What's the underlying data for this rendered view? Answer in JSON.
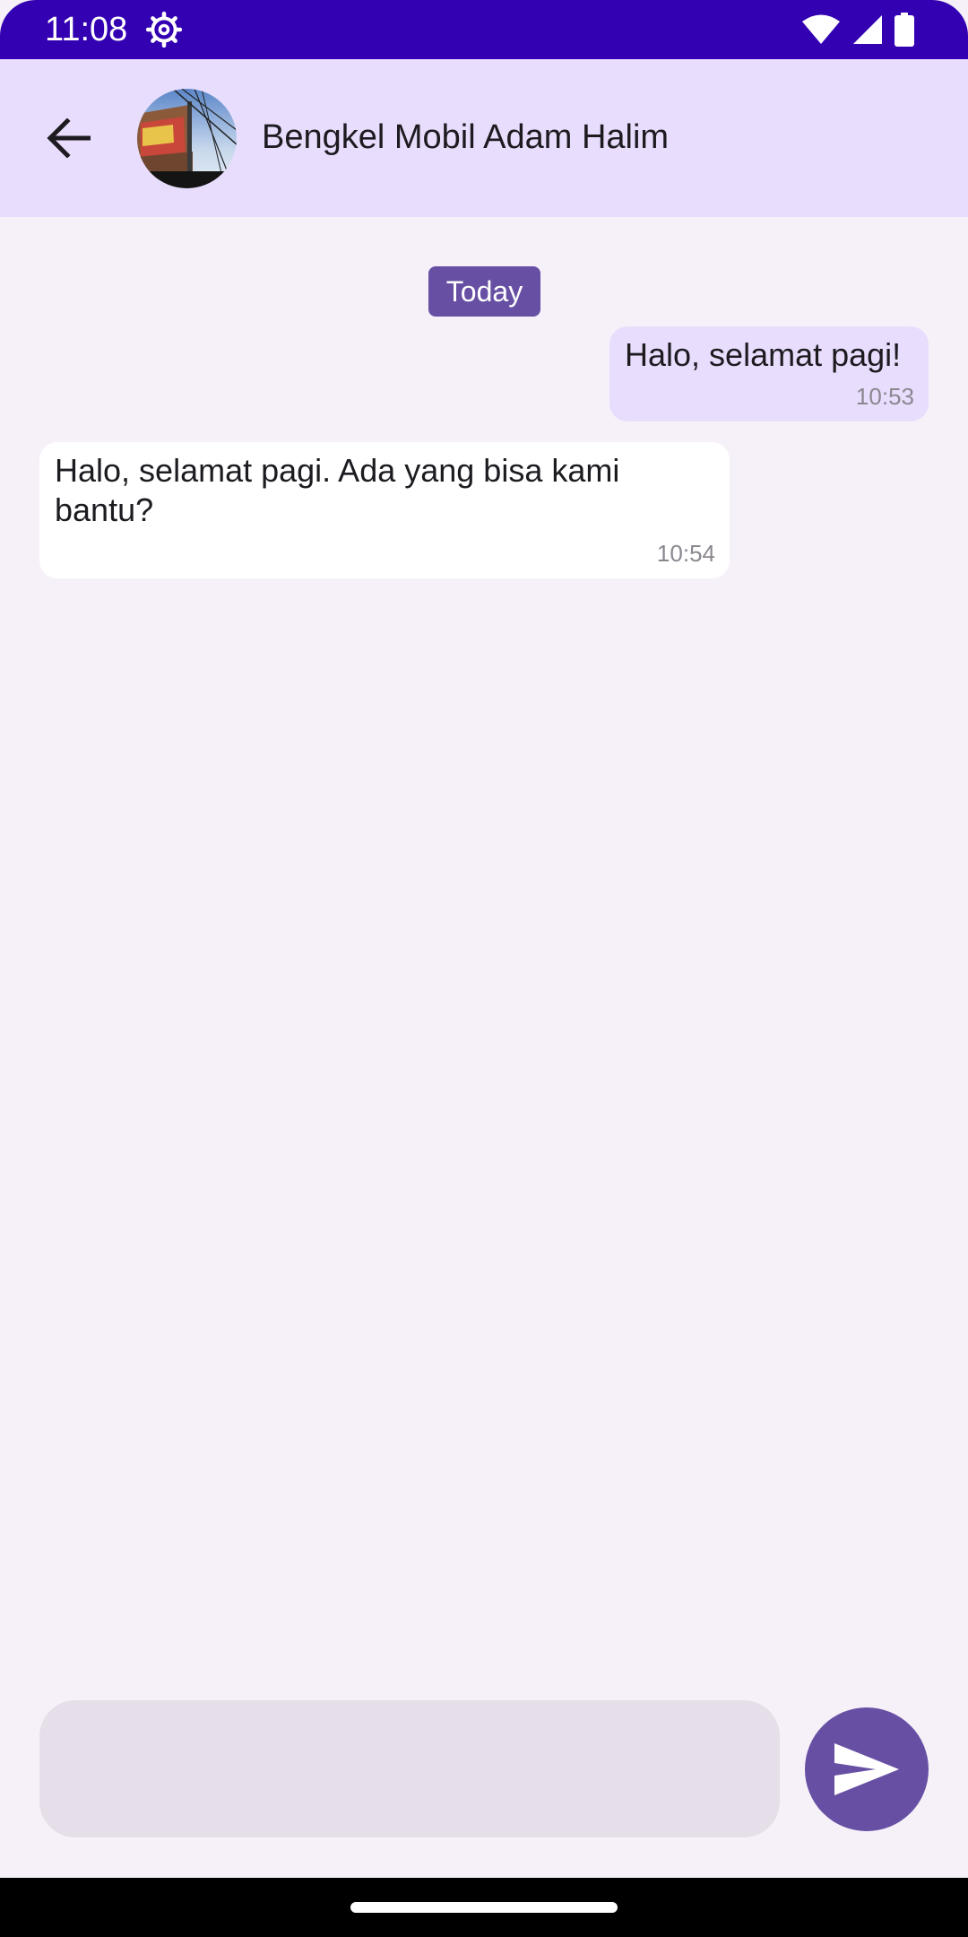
{
  "status_bar": {
    "time": "11:08",
    "icons": [
      "settings-gear-icon",
      "wifi-icon",
      "cell-signal-icon",
      "battery-icon"
    ],
    "color": "#3300b2"
  },
  "header": {
    "contact_name": "Bengkel Mobil Adam Halim",
    "back_icon": "arrow-back-icon",
    "background": "#e9ddfd"
  },
  "conversation": {
    "date_label": "Today",
    "messages": [
      {
        "direction": "outgoing",
        "text": "Halo, selamat pagi!",
        "time": "10:53"
      },
      {
        "direction": "incoming",
        "text": "Halo, selamat pagi. Ada yang bisa kami bantu?",
        "time": "10:54"
      }
    ]
  },
  "composer": {
    "input_value": "",
    "send_icon": "send-icon"
  },
  "colors": {
    "accent": "#6750a4",
    "background": "#f6f1f9",
    "outgoing_bubble": "#e9ddfd",
    "incoming_bubble": "#ffffff"
  }
}
